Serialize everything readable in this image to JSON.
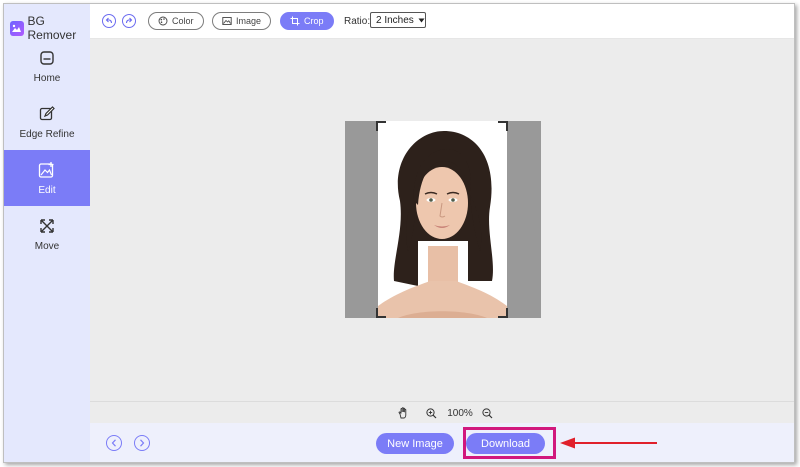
{
  "app": {
    "title": "BG Remover"
  },
  "sidebar": {
    "items": [
      {
        "label": "Home",
        "icon": "home-icon",
        "active": false
      },
      {
        "label": "Edge Refine",
        "icon": "edit-pencil-icon",
        "active": false
      },
      {
        "label": "Edit",
        "icon": "image-edit-icon",
        "active": true
      },
      {
        "label": "Move",
        "icon": "move-icon",
        "active": false
      }
    ]
  },
  "toolbar": {
    "color_label": "Color",
    "image_label": "Image",
    "crop_label": "Crop",
    "ratio_label": "Ratio:",
    "ratio_value": "2 Inches"
  },
  "zoom": {
    "level": "100%"
  },
  "bottom": {
    "new_image_label": "New Image",
    "download_label": "Download"
  },
  "colors": {
    "accent": "#7b7cf7",
    "sidebar_bg": "#e4e8fd",
    "highlight": "#d1187d",
    "arrow": "#e0202b"
  }
}
